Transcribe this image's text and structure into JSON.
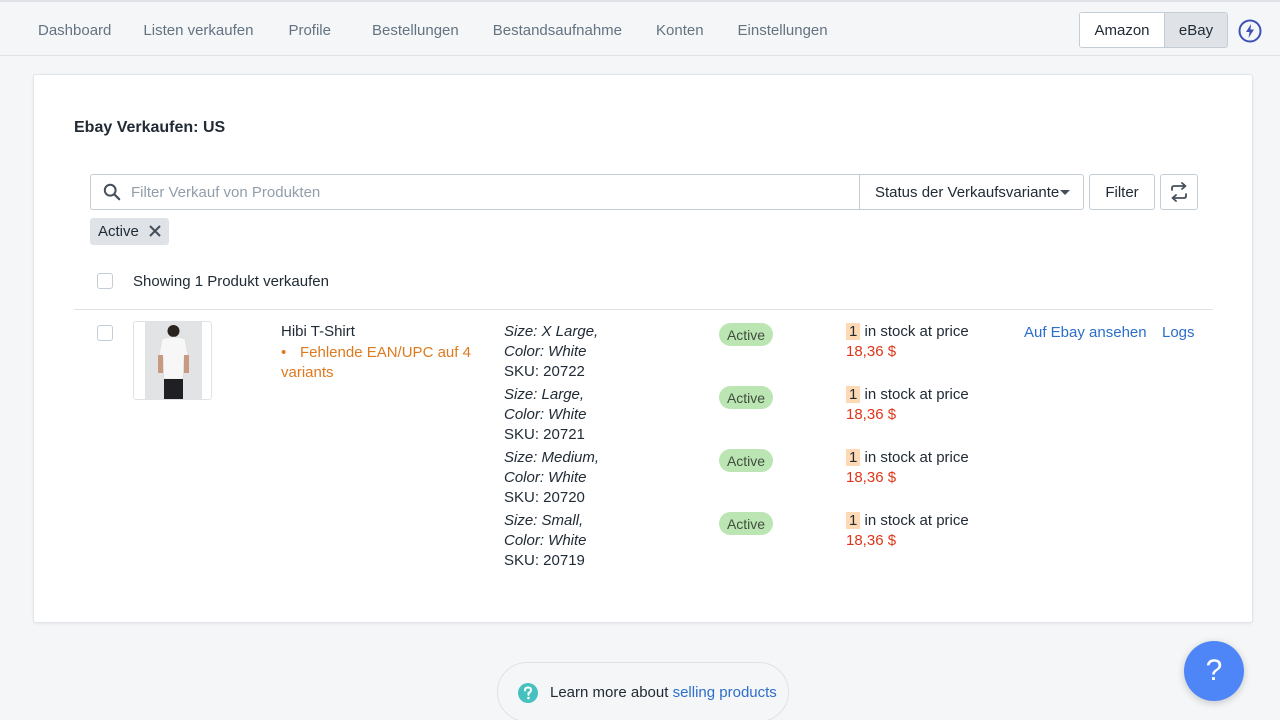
{
  "nav": {
    "items": [
      {
        "label": "Dashboard"
      },
      {
        "label": "Listen verkaufen"
      },
      {
        "label": "Profile"
      },
      {
        "label": "Bestellungen"
      },
      {
        "label": "Bestandsaufnahme"
      },
      {
        "label": "Konten"
      },
      {
        "label": "Einstellungen"
      }
    ],
    "marketplaces": {
      "amazon": "Amazon",
      "ebay": "eBay",
      "selected": "eBay"
    }
  },
  "page": {
    "title": "Ebay Verkaufen: US",
    "search": {
      "placeholder": "Filter Verkauf von Produkten",
      "value": ""
    },
    "status_dropdown": "Status der Verkaufsvariante",
    "filter_button": "Filter",
    "applied_tag": "Active",
    "showing_text": "Showing 1 Produkt verkaufen"
  },
  "product": {
    "name": "Hibi T-Shirt",
    "warning_bullet": "•",
    "warning": "Fehlende EAN/UPC auf 4 variants",
    "view_link": "Auf Ebay ansehen",
    "logs_link": "Logs",
    "variants": [
      {
        "size": "Size: X Large,",
        "color": "Color: White",
        "sku": "SKU: 20722",
        "status": "Active",
        "qty": "1",
        "stock_text": " in stock at price",
        "price": "18,36 $"
      },
      {
        "size": "Size: Large,",
        "color": "Color: White",
        "sku": "SKU: 20721",
        "status": "Active",
        "qty": "1",
        "stock_text": " in stock at price",
        "price": "18,36 $"
      },
      {
        "size": "Size: Medium,",
        "color": "Color: White",
        "sku": "SKU: 20720",
        "status": "Active",
        "qty": "1",
        "stock_text": " in stock at price",
        "price": "18,36 $"
      },
      {
        "size": "Size: Small,",
        "color": "Color: White",
        "sku": "SKU: 20719",
        "status": "Active",
        "qty": "1",
        "stock_text": " in stock at price",
        "price": "18,36 $"
      }
    ]
  },
  "footer": {
    "learn_prefix": "Learn more about ",
    "learn_link": "selling products",
    "help_label": "?"
  },
  "colors": {
    "accent_link": "#2c6ecb",
    "warning": "#de7a1d",
    "price": "#de3618",
    "badge_active": "#bbe5b3",
    "help_fab": "#4f86f7"
  },
  "icons": [
    "search-icon",
    "chevron-down-icon",
    "sync-icon",
    "close-icon",
    "lightning-icon",
    "help-circle-icon"
  ]
}
